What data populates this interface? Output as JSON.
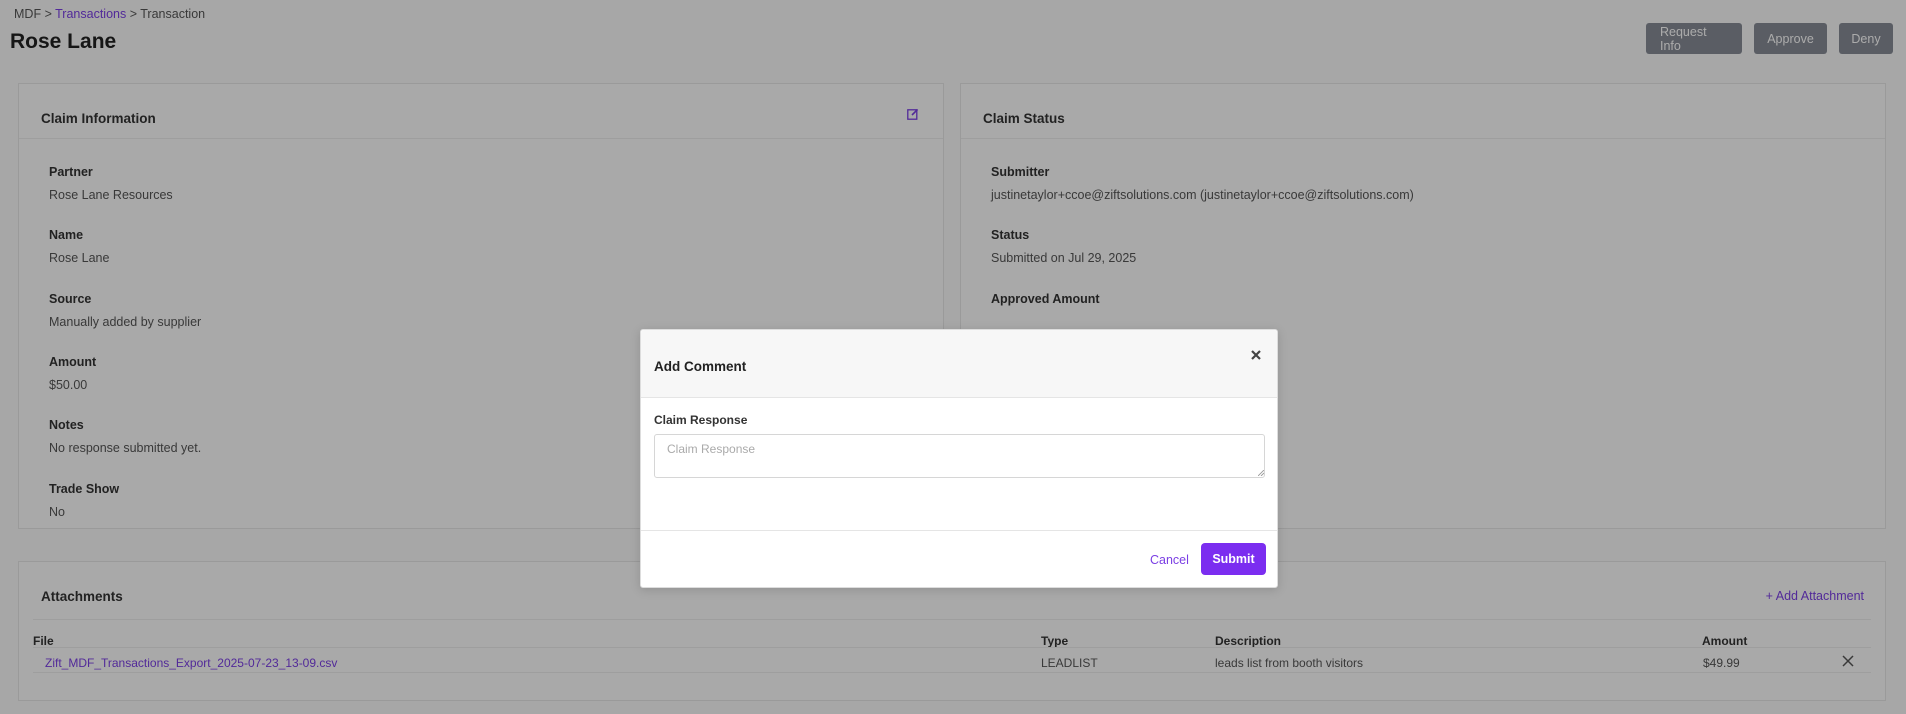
{
  "breadcrumb": {
    "root": "MDF",
    "sep1": ">",
    "transactions": "Transactions",
    "sep2": ">",
    "current": "Transaction"
  },
  "page_title": "Rose Lane",
  "actions": {
    "request_info": "Request Info",
    "approve": "Approve",
    "deny": "Deny"
  },
  "claim_info": {
    "title": "Claim Information",
    "edit_icon": "edit-icon",
    "fields": [
      {
        "label": "Partner",
        "value": "Rose Lane Resources"
      },
      {
        "label": "Name",
        "value": "Rose Lane"
      },
      {
        "label": "Source",
        "value": "Manually added by supplier"
      },
      {
        "label": "Amount",
        "value": "$50.00"
      },
      {
        "label": "Notes",
        "value": "No response submitted yet."
      },
      {
        "label": "Trade Show",
        "value": "No"
      }
    ]
  },
  "claim_status": {
    "title": "Claim Status",
    "fields": [
      {
        "label": "Submitter",
        "value": "justinetaylor+ccoe@ziftsolutions.com (justinetaylor+ccoe@ziftsolutions.com)"
      },
      {
        "label": "Status",
        "value": "Submitted on Jul 29, 2025"
      },
      {
        "label": "Approved Amount",
        "value": ""
      }
    ]
  },
  "attachments": {
    "title": "Attachments",
    "add_label": "+ Add Attachment",
    "columns": [
      "File",
      "Type",
      "Description",
      "Amount"
    ],
    "rows": [
      {
        "file": "Zift_MDF_Transactions_Export_2025-07-23_13-09.csv",
        "type": "LEADLIST",
        "description": "leads list from booth visitors",
        "amount": "$49.99"
      }
    ]
  },
  "modal": {
    "title": "Add Comment",
    "close_icon": "close-icon",
    "field_label": "Claim Response",
    "placeholder": "Claim Response",
    "value": "",
    "cancel_label": "Cancel",
    "submit_label": "Submit"
  },
  "colors": {
    "accent": "#7b2df0",
    "link": "#7b3fe4",
    "gray_button": "#878b95"
  }
}
